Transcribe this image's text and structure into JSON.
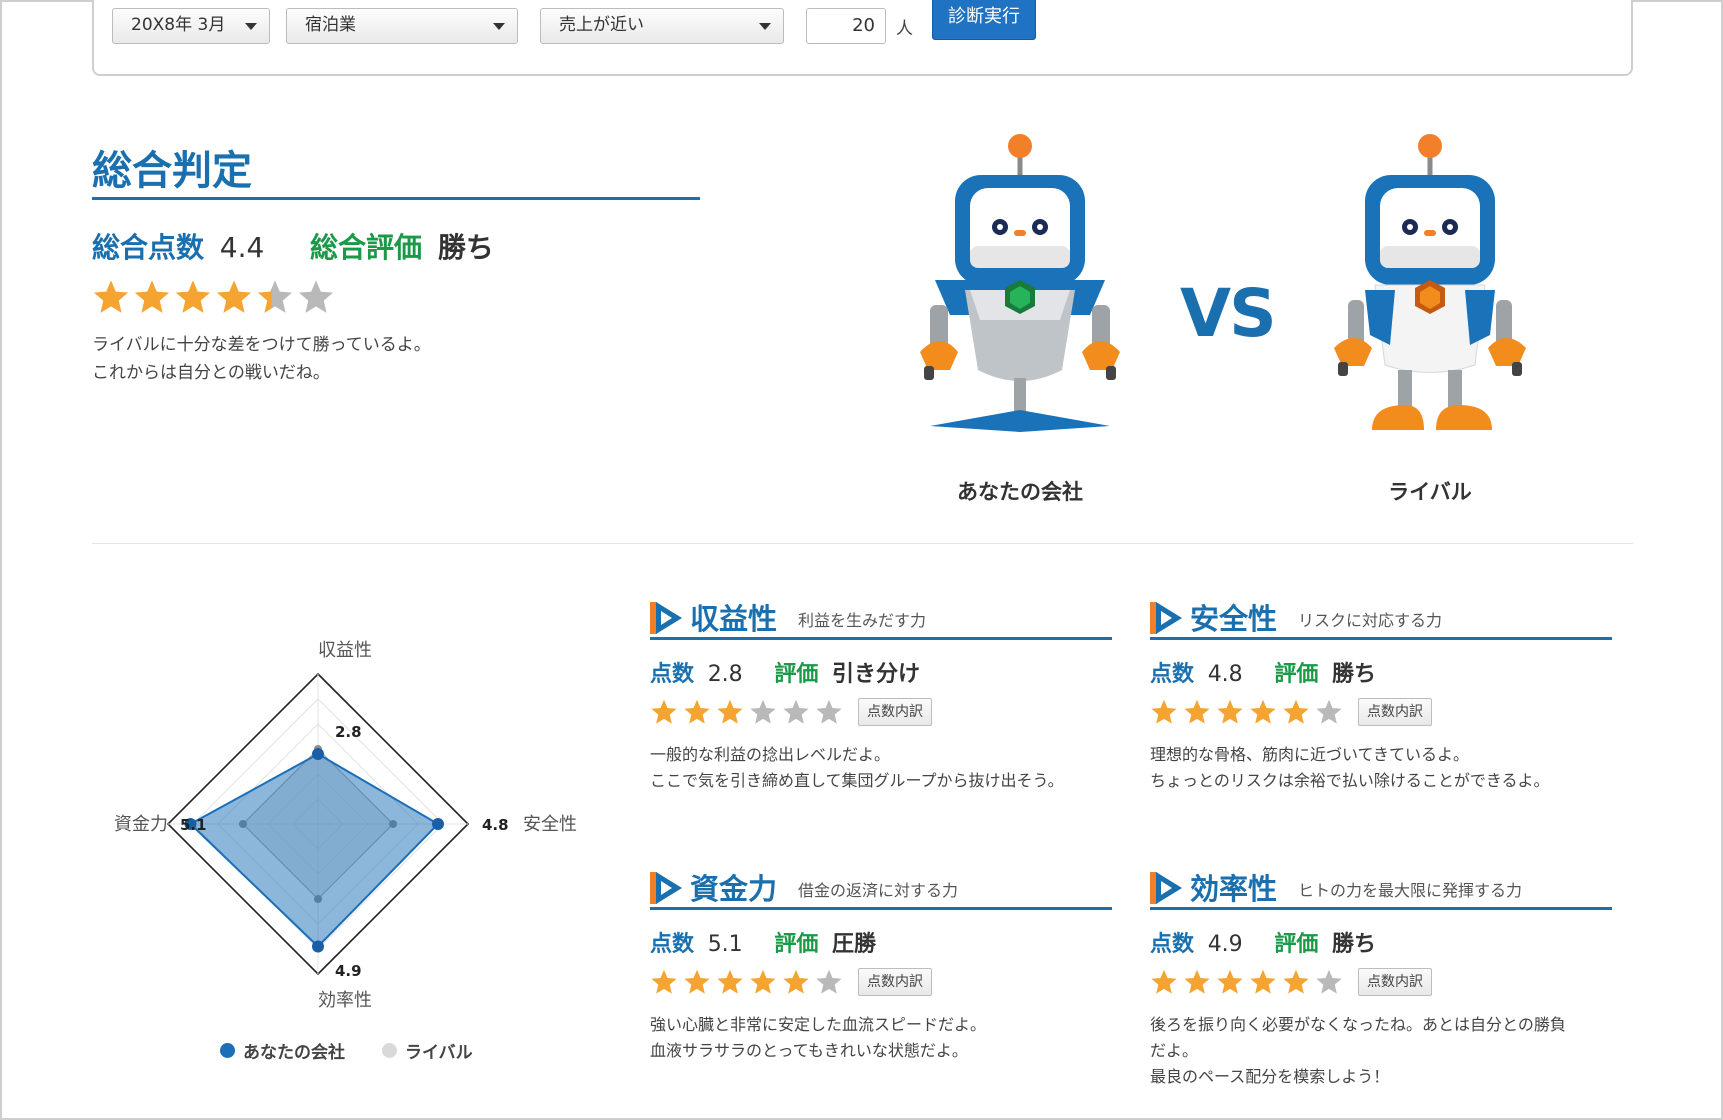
{
  "form": {
    "period": "20X8年 3月",
    "industry": "宿泊業",
    "criteria": "売上が近い",
    "employees": "20",
    "unit": "人",
    "run_label": "診断実行"
  },
  "overall": {
    "title": "総合判定",
    "score_label": "総合点数",
    "score": "4.4",
    "eval_label": "総合評価",
    "eval": "勝ち",
    "stars": 4.4,
    "comment_line1": "ライバルに十分な差をつけて勝っているよ。",
    "comment_line2": "これからは自分との戦いだね。"
  },
  "robots": {
    "vs": "VS",
    "you": "あなたの会社",
    "rival": "ライバル"
  },
  "radar": {
    "labels": {
      "top": "収益性",
      "right": "安全性",
      "bottom": "効率性",
      "left": "資金力"
    },
    "values": {
      "top": "2.8",
      "right": "4.8",
      "bottom": "4.9",
      "left": "5.1"
    },
    "legend_you": "あなたの会社",
    "legend_rival": "ライバル"
  },
  "chart_data": {
    "type": "radar",
    "categories": [
      "収益性",
      "安全性",
      "効率性",
      "資金力"
    ],
    "max": 6,
    "series": [
      {
        "name": "あなたの会社",
        "values": [
          2.8,
          4.8,
          4.9,
          5.1
        ],
        "color": "#1a6fb8"
      },
      {
        "name": "ライバル",
        "values": [
          3.0,
          3.0,
          3.0,
          3.0
        ],
        "color": "#bdbdbd"
      }
    ],
    "legend": "bottom"
  },
  "cards": [
    {
      "title": "収益性",
      "subtitle": "利益を生みだす力",
      "score_label": "点数",
      "score": "2.8",
      "eval_label": "評価",
      "eval": "引き分け",
      "stars": 3,
      "detail": "点数内訳",
      "comment1": "一般的な利益の捻出レベルだよ。",
      "comment2": "ここで気を引き締め直して集団グループから抜け出そう。",
      "comment3": ""
    },
    {
      "title": "安全性",
      "subtitle": "リスクに対応する力",
      "score_label": "点数",
      "score": "4.8",
      "eval_label": "評価",
      "eval": "勝ち",
      "stars": 5,
      "detail": "点数内訳",
      "comment1": "理想的な骨格、筋肉に近づいてきているよ。",
      "comment2": "ちょっとのリスクは余裕で払い除けることができるよ。",
      "comment3": ""
    },
    {
      "title": "資金力",
      "subtitle": "借金の返済に対する力",
      "score_label": "点数",
      "score": "5.1",
      "eval_label": "評価",
      "eval": "圧勝",
      "stars": 5,
      "detail": "点数内訳",
      "comment1": "強い心臓と非常に安定した血流スピードだよ。",
      "comment2": "血液サラサラのとってもきれいな状態だよ。",
      "comment3": ""
    },
    {
      "title": "効率性",
      "subtitle": "ヒトの力を最大限に発揮する力",
      "score_label": "点数",
      "score": "4.9",
      "eval_label": "評価",
      "eval": "勝ち",
      "stars": 5,
      "detail": "点数内訳",
      "comment1": "後ろを振り向く必要がなくなったね。あとは自分との勝負",
      "comment2": "だよ。",
      "comment3": "最良のペース配分を模索しよう！"
    }
  ],
  "colors": {
    "accent": "#1a6fae",
    "green": "#1a9a49",
    "star": "#f5a431",
    "star_empty": "#b9b9b9",
    "button": "#1f73c2"
  }
}
